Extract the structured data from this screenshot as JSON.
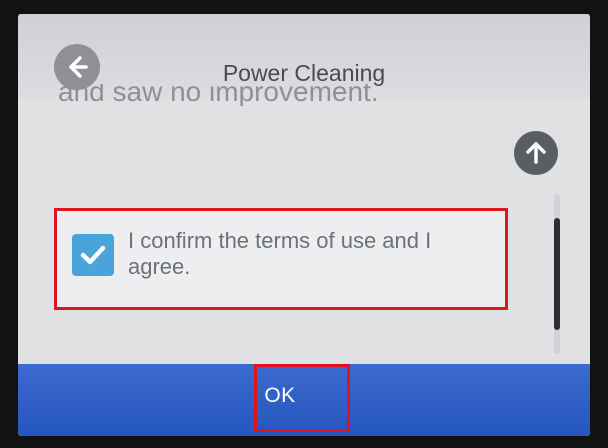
{
  "header": {
    "title": "Power Cleaning",
    "back_icon": "arrow-left-icon"
  },
  "content": {
    "clipped_text": "and saw no improvement.",
    "scroll_up_icon": "arrow-up-icon",
    "confirm": {
      "checked": true,
      "text": "I confirm the terms of use and I agree."
    },
    "scroll_position": 0.55
  },
  "footer": {
    "ok_label": "OK"
  },
  "colors": {
    "accent": "#2456c0",
    "checkbox": "#4aa3d9",
    "highlight": "#e0141d"
  }
}
